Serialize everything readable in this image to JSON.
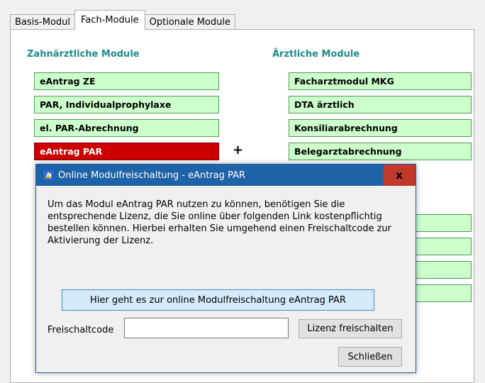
{
  "tabs": [
    "Basis-Modul",
    "Fach-Module",
    "Optionale Module"
  ],
  "sections": {
    "dental_title": "Zahnärztliche Module",
    "medical_title": "Ärztliche Module"
  },
  "dental_modules": [
    "eAntrag ZE",
    "PAR, Individualprophylaxe",
    "el. PAR-Abrechnung",
    "eAntrag PAR"
  ],
  "medical_modules": [
    "Facharztmodul MKG",
    "DTA ärztlich",
    "Konsiliarabrechnung",
    "Belegarztabrechnung"
  ],
  "plus_symbol": "+",
  "dialog": {
    "title": "Online Modulfreischaltung - eAntrag PAR",
    "close_label": "x",
    "message": "Um das Modul eAntrag PAR nutzen zu können, benötigen Sie die entsprechende Lizenz, die Sie online über folgenden Link kostenpflichtig bestellen können. Hierbei erhalten Sie umgehend einen Freischaltcode zur Aktivierung der Lizenz.",
    "link_button": "Hier geht es zur online Modulfreischaltung eAntrag PAR",
    "code_label": "Freischaltcode",
    "code_value": "",
    "unlock_button": "Lizenz freischalten",
    "close_button": "Schließen"
  },
  "colors": {
    "module_bg": "#ccffcc",
    "module_selected_bg": "#cc0000",
    "section_title": "#1f8a8a",
    "titlebar": "#1e62a8",
    "close_button": "#c0392b"
  }
}
